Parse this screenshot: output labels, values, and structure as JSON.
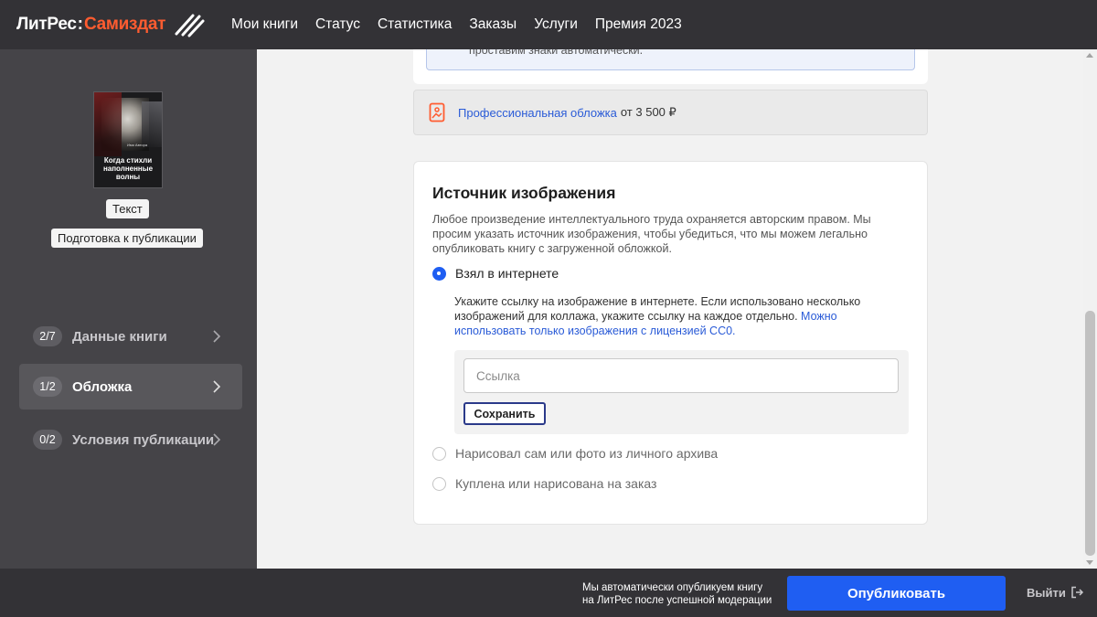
{
  "header": {
    "logo_part1": "ЛитРес",
    "logo_colon": ":",
    "logo_part2": "Самиздат",
    "nav": [
      "Мои книги",
      "Статус",
      "Статистика",
      "Заказы",
      "Услуги",
      "Премия 2023"
    ]
  },
  "sidebar": {
    "book_cover": {
      "title": "Когда стихли наполненные волны",
      "author": "Имя Автора"
    },
    "type_chip": "Текст",
    "stage_chip": "Подготовка к публикации",
    "steps": [
      {
        "badge": "2/7",
        "label": "Данные книги",
        "active": false
      },
      {
        "badge": "1/2",
        "label": "Обложка",
        "active": true
      },
      {
        "badge": "0/2",
        "label": "Условия публикации",
        "active": false
      }
    ]
  },
  "main": {
    "info_tail": "проставим знаки автоматически.",
    "pro_cover": {
      "link": "Профессиональная обложка",
      "price": "от 3 500 ₽"
    },
    "image_source": {
      "title": "Источник изображения",
      "description": "Любое произведение интеллектуального труда охраняется авторским правом. Мы просим указать источник изображения, чтобы убедиться, что мы можем легально опубликовать книгу с загруженной обложкой.",
      "options": [
        {
          "label": "Взял в интернете",
          "checked": true
        },
        {
          "label": "Нарисовал сам или фото из личного архива",
          "checked": false
        },
        {
          "label": "Куплена или нарисована на заказ",
          "checked": false
        }
      ],
      "option_desc": "Укажите ссылку на изображение в интернете. Если использовано несколько изображений для коллажа, укажите ссылку на каждое отдельно. ",
      "option_link": "Можно использовать только изображения с лицензией CC0.",
      "link_input": {
        "placeholder": "Ссылка",
        "value": ""
      },
      "save_label": "Сохранить"
    }
  },
  "footer": {
    "note_line1": "Мы автоматически опубликуем книгу",
    "note_line2": "на ЛитРес после успешной модерации",
    "publish_label": "Опубликовать",
    "exit_label": "Выйти"
  },
  "colors": {
    "accent_blue": "#1f5ef2",
    "logo_orange": "#ff5c30",
    "dark_bg": "#333236",
    "sidebar_bg": "#454448"
  },
  "icons": {
    "logo_mark": "pen-strokes-icon",
    "pro_cover": "image-frame-icon",
    "step_chevron": "chevron-right-icon",
    "exit": "logout-icon"
  }
}
